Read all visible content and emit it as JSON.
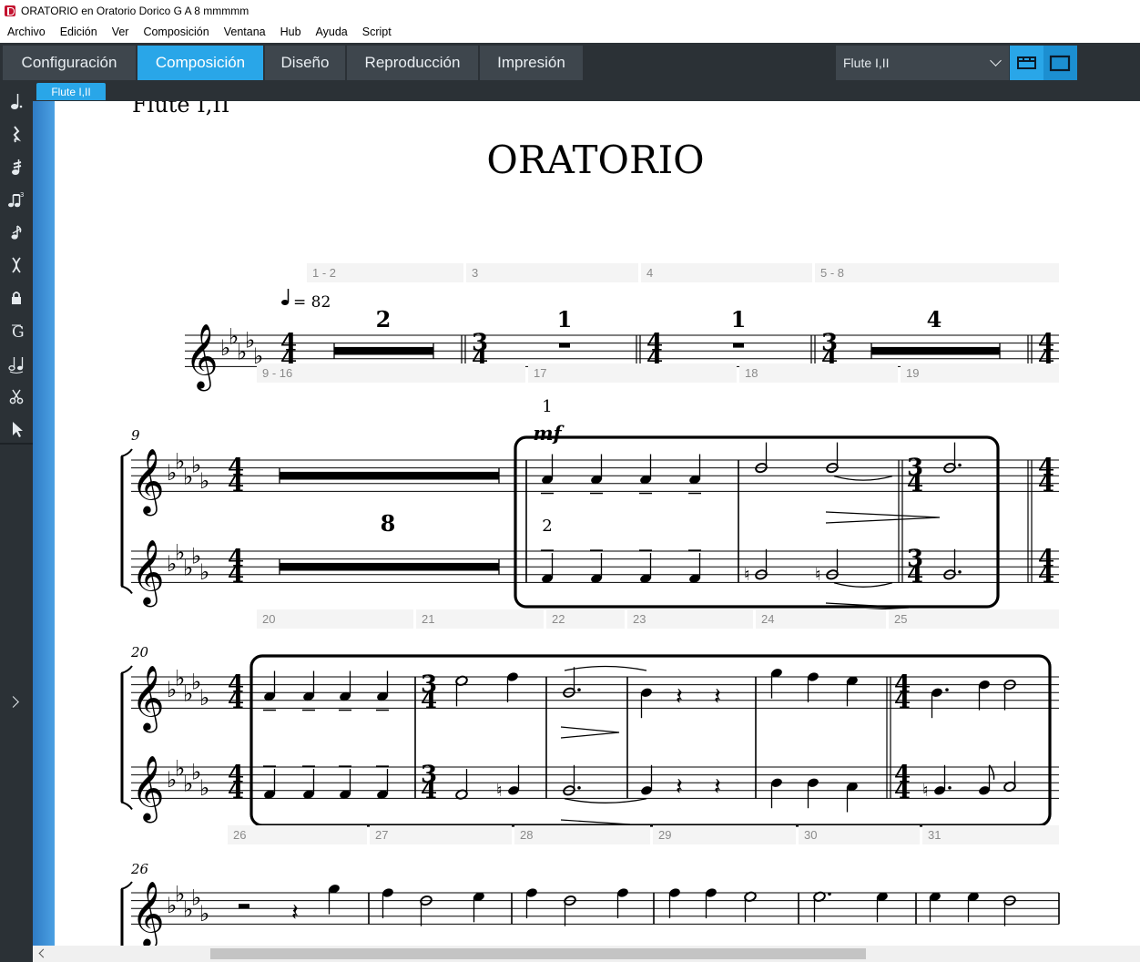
{
  "window": {
    "title": "ORATORIO en Oratorio Dorico   G A 8 mmmmm"
  },
  "menu": [
    "Archivo",
    "Edición",
    "Ver",
    "Composición",
    "Ventana",
    "Hub",
    "Ayuda",
    "Script"
  ],
  "modes": {
    "tabs": [
      {
        "label": "Configuración",
        "active": false
      },
      {
        "label": "Composición",
        "active": true
      },
      {
        "label": "Diseño",
        "active": false
      },
      {
        "label": "Reproducción",
        "active": false
      },
      {
        "label": "Impresión",
        "active": false
      }
    ],
    "layout_select": "Flute I,II",
    "accent_color": "#29a6e8"
  },
  "toolbar_left": {
    "tools": [
      "note-input-icon",
      "rest-icon",
      "tremolo-icon",
      "tuplet-icon",
      "grace-note-icon",
      "stem-icon",
      "lock-icon",
      "clef-icon",
      "slur-icon",
      "scissors-icon",
      "select-icon"
    ]
  },
  "document_tab": "Flute I,II",
  "score": {
    "header_part": "Flute I,II",
    "title": "ORATORIO",
    "tempo": "= 82",
    "system1_labels": [
      "1 - 2",
      "3",
      "4",
      "5 - 8"
    ],
    "system1_rests": [
      "2",
      "1",
      "1",
      "4"
    ],
    "system1_timesig": [
      "4/4",
      "3/4",
      "4/4",
      "3/4",
      "4/4"
    ],
    "system2_labels": [
      "9 - 16",
      "17",
      "18",
      "19"
    ],
    "system2_measure_no": "9",
    "system2_multirest": "8",
    "system2_player1": "1",
    "system2_player2": "2",
    "system2_dynamic": "mf",
    "system3_labels": [
      "20",
      "21",
      "22",
      "23",
      "24",
      "25"
    ],
    "system3_measure_no": "20",
    "system4_labels": [
      "26",
      "27",
      "28",
      "29",
      "30",
      "31"
    ],
    "system4_measure_no": "26"
  }
}
